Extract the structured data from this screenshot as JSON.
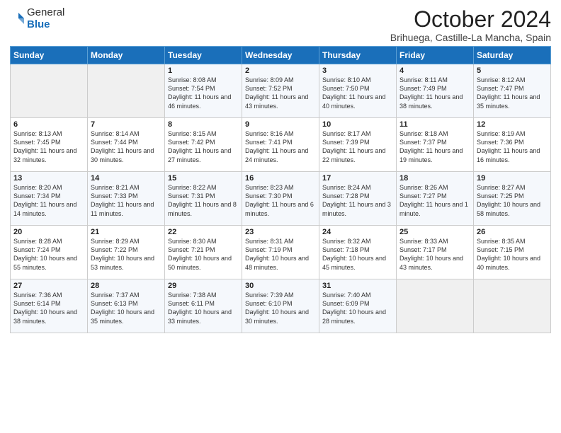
{
  "logo": {
    "general": "General",
    "blue": "Blue"
  },
  "title": "October 2024",
  "location": "Brihuega, Castille-La Mancha, Spain",
  "days_of_week": [
    "Sunday",
    "Monday",
    "Tuesday",
    "Wednesday",
    "Thursday",
    "Friday",
    "Saturday"
  ],
  "weeks": [
    [
      {
        "day": "",
        "sunrise": "",
        "sunset": "",
        "daylight": ""
      },
      {
        "day": "",
        "sunrise": "",
        "sunset": "",
        "daylight": ""
      },
      {
        "day": "1",
        "sunrise": "Sunrise: 8:08 AM",
        "sunset": "Sunset: 7:54 PM",
        "daylight": "Daylight: 11 hours and 46 minutes."
      },
      {
        "day": "2",
        "sunrise": "Sunrise: 8:09 AM",
        "sunset": "Sunset: 7:52 PM",
        "daylight": "Daylight: 11 hours and 43 minutes."
      },
      {
        "day": "3",
        "sunrise": "Sunrise: 8:10 AM",
        "sunset": "Sunset: 7:50 PM",
        "daylight": "Daylight: 11 hours and 40 minutes."
      },
      {
        "day": "4",
        "sunrise": "Sunrise: 8:11 AM",
        "sunset": "Sunset: 7:49 PM",
        "daylight": "Daylight: 11 hours and 38 minutes."
      },
      {
        "day": "5",
        "sunrise": "Sunrise: 8:12 AM",
        "sunset": "Sunset: 7:47 PM",
        "daylight": "Daylight: 11 hours and 35 minutes."
      }
    ],
    [
      {
        "day": "6",
        "sunrise": "Sunrise: 8:13 AM",
        "sunset": "Sunset: 7:45 PM",
        "daylight": "Daylight: 11 hours and 32 minutes."
      },
      {
        "day": "7",
        "sunrise": "Sunrise: 8:14 AM",
        "sunset": "Sunset: 7:44 PM",
        "daylight": "Daylight: 11 hours and 30 minutes."
      },
      {
        "day": "8",
        "sunrise": "Sunrise: 8:15 AM",
        "sunset": "Sunset: 7:42 PM",
        "daylight": "Daylight: 11 hours and 27 minutes."
      },
      {
        "day": "9",
        "sunrise": "Sunrise: 8:16 AM",
        "sunset": "Sunset: 7:41 PM",
        "daylight": "Daylight: 11 hours and 24 minutes."
      },
      {
        "day": "10",
        "sunrise": "Sunrise: 8:17 AM",
        "sunset": "Sunset: 7:39 PM",
        "daylight": "Daylight: 11 hours and 22 minutes."
      },
      {
        "day": "11",
        "sunrise": "Sunrise: 8:18 AM",
        "sunset": "Sunset: 7:37 PM",
        "daylight": "Daylight: 11 hours and 19 minutes."
      },
      {
        "day": "12",
        "sunrise": "Sunrise: 8:19 AM",
        "sunset": "Sunset: 7:36 PM",
        "daylight": "Daylight: 11 hours and 16 minutes."
      }
    ],
    [
      {
        "day": "13",
        "sunrise": "Sunrise: 8:20 AM",
        "sunset": "Sunset: 7:34 PM",
        "daylight": "Daylight: 11 hours and 14 minutes."
      },
      {
        "day": "14",
        "sunrise": "Sunrise: 8:21 AM",
        "sunset": "Sunset: 7:33 PM",
        "daylight": "Daylight: 11 hours and 11 minutes."
      },
      {
        "day": "15",
        "sunrise": "Sunrise: 8:22 AM",
        "sunset": "Sunset: 7:31 PM",
        "daylight": "Daylight: 11 hours and 8 minutes."
      },
      {
        "day": "16",
        "sunrise": "Sunrise: 8:23 AM",
        "sunset": "Sunset: 7:30 PM",
        "daylight": "Daylight: 11 hours and 6 minutes."
      },
      {
        "day": "17",
        "sunrise": "Sunrise: 8:24 AM",
        "sunset": "Sunset: 7:28 PM",
        "daylight": "Daylight: 11 hours and 3 minutes."
      },
      {
        "day": "18",
        "sunrise": "Sunrise: 8:26 AM",
        "sunset": "Sunset: 7:27 PM",
        "daylight": "Daylight: 11 hours and 1 minute."
      },
      {
        "day": "19",
        "sunrise": "Sunrise: 8:27 AM",
        "sunset": "Sunset: 7:25 PM",
        "daylight": "Daylight: 10 hours and 58 minutes."
      }
    ],
    [
      {
        "day": "20",
        "sunrise": "Sunrise: 8:28 AM",
        "sunset": "Sunset: 7:24 PM",
        "daylight": "Daylight: 10 hours and 55 minutes."
      },
      {
        "day": "21",
        "sunrise": "Sunrise: 8:29 AM",
        "sunset": "Sunset: 7:22 PM",
        "daylight": "Daylight: 10 hours and 53 minutes."
      },
      {
        "day": "22",
        "sunrise": "Sunrise: 8:30 AM",
        "sunset": "Sunset: 7:21 PM",
        "daylight": "Daylight: 10 hours and 50 minutes."
      },
      {
        "day": "23",
        "sunrise": "Sunrise: 8:31 AM",
        "sunset": "Sunset: 7:19 PM",
        "daylight": "Daylight: 10 hours and 48 minutes."
      },
      {
        "day": "24",
        "sunrise": "Sunrise: 8:32 AM",
        "sunset": "Sunset: 7:18 PM",
        "daylight": "Daylight: 10 hours and 45 minutes."
      },
      {
        "day": "25",
        "sunrise": "Sunrise: 8:33 AM",
        "sunset": "Sunset: 7:17 PM",
        "daylight": "Daylight: 10 hours and 43 minutes."
      },
      {
        "day": "26",
        "sunrise": "Sunrise: 8:35 AM",
        "sunset": "Sunset: 7:15 PM",
        "daylight": "Daylight: 10 hours and 40 minutes."
      }
    ],
    [
      {
        "day": "27",
        "sunrise": "Sunrise: 7:36 AM",
        "sunset": "Sunset: 6:14 PM",
        "daylight": "Daylight: 10 hours and 38 minutes."
      },
      {
        "day": "28",
        "sunrise": "Sunrise: 7:37 AM",
        "sunset": "Sunset: 6:13 PM",
        "daylight": "Daylight: 10 hours and 35 minutes."
      },
      {
        "day": "29",
        "sunrise": "Sunrise: 7:38 AM",
        "sunset": "Sunset: 6:11 PM",
        "daylight": "Daylight: 10 hours and 33 minutes."
      },
      {
        "day": "30",
        "sunrise": "Sunrise: 7:39 AM",
        "sunset": "Sunset: 6:10 PM",
        "daylight": "Daylight: 10 hours and 30 minutes."
      },
      {
        "day": "31",
        "sunrise": "Sunrise: 7:40 AM",
        "sunset": "Sunset: 6:09 PM",
        "daylight": "Daylight: 10 hours and 28 minutes."
      },
      {
        "day": "",
        "sunrise": "",
        "sunset": "",
        "daylight": ""
      },
      {
        "day": "",
        "sunrise": "",
        "sunset": "",
        "daylight": ""
      }
    ]
  ]
}
